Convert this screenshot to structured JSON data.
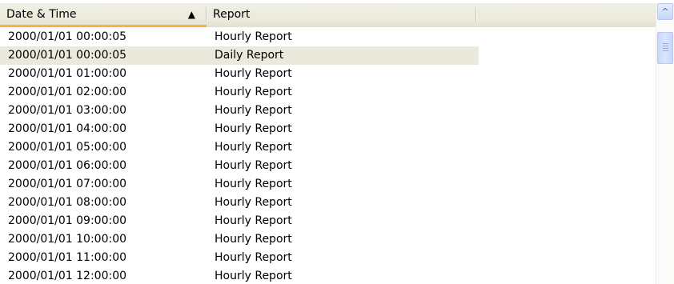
{
  "header": {
    "date_label": "Date & Time",
    "report_label": "Report",
    "sort_indicator": "▲",
    "sort_icon": "sort-ascending-icon",
    "sorted_column_accent": "#f9b240"
  },
  "rows": [
    {
      "date": "2000/01/01 00:00:05",
      "report": "Hourly Report"
    },
    {
      "date": "2000/01/01 00:00:05",
      "report": "Daily Report",
      "selected": true
    },
    {
      "date": "2000/01/01 01:00:00",
      "report": "Hourly Report"
    },
    {
      "date": "2000/01/01 02:00:00",
      "report": "Hourly Report"
    },
    {
      "date": "2000/01/01 03:00:00",
      "report": "Hourly Report"
    },
    {
      "date": "2000/01/01 04:00:00",
      "report": "Hourly Report"
    },
    {
      "date": "2000/01/01 05:00:00",
      "report": "Hourly Report"
    },
    {
      "date": "2000/01/01 06:00:00",
      "report": "Hourly Report"
    },
    {
      "date": "2000/01/01 07:00:00",
      "report": "Hourly Report"
    },
    {
      "date": "2000/01/01 08:00:00",
      "report": "Hourly Report"
    },
    {
      "date": "2000/01/01 09:00:00",
      "report": "Hourly Report"
    },
    {
      "date": "2000/01/01 10:00:00",
      "report": "Hourly Report"
    },
    {
      "date": "2000/01/01 11:00:00",
      "report": "Hourly Report"
    },
    {
      "date": "2000/01/01 12:00:00",
      "report": "Hourly Report"
    }
  ],
  "scrollbar": {
    "up_arrow": "^",
    "up_icon": "scroll-up-arrow-icon"
  },
  "colors": {
    "selected_row": "#ebe9dc",
    "header_bg": "#ebeadb",
    "scrollbar_accent": "#c6d7fb"
  }
}
